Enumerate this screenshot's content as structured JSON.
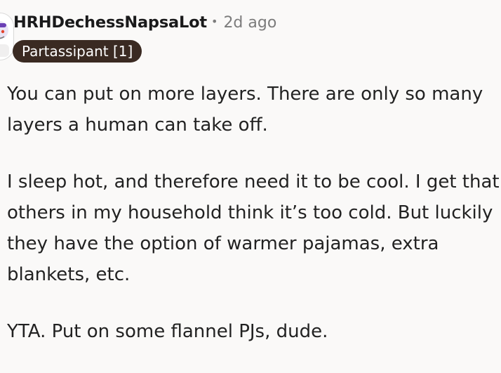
{
  "comment": {
    "author": "HRHDechessNapsaLot",
    "separator": "•",
    "time_ago": "2d ago",
    "flair": "Partassipant [1]",
    "paragraphs": [
      "You can put on more layers. There are only so many layers a human can take off.",
      "I sleep hot, and therefore need it to be cool. I get that others in my household think it’s too cold. But luckily they have the option of warmer pajamas, extra blankets, etc.",
      "YTA. Put on some flannel PJs, dude."
    ]
  },
  "colors": {
    "background": "#faf9f8",
    "flair_bg": "#3a2a22",
    "flair_text": "#ffffff",
    "meta_text": "#7c7c7c"
  },
  "icons": {
    "avatar": "user-avatar-snoo"
  }
}
